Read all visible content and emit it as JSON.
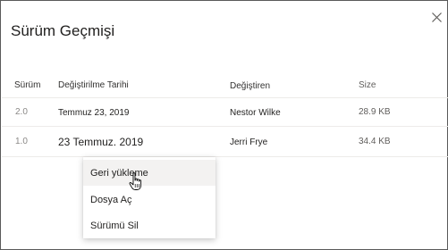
{
  "dialog": {
    "title": "Sürüm Geçmişi",
    "close_icon": "close-icon"
  },
  "table": {
    "headers": {
      "version": "Sürüm",
      "modified_date": "Değiştirilme Tarihi",
      "modified_by": "Değiştiren",
      "size": "Size"
    },
    "rows": [
      {
        "version": "2.0",
        "date": "Temmuz 23, 2019",
        "modified_by": "Nestor Wilke",
        "size": "28.9 KB"
      },
      {
        "version": "1.0",
        "date": "23 Temmuz. 2019",
        "modified_by": "Jerri Frye",
        "size": "34.4 KB"
      }
    ]
  },
  "context_menu": {
    "items": [
      {
        "label": "Geri yükleme"
      },
      {
        "label": "Dosya Aç"
      },
      {
        "label": "Sürümü Sil"
      }
    ]
  },
  "colors": {
    "border": "#5a5a5a",
    "separator": "#edebe9",
    "hover": "#f3f2f1",
    "muted_text": "#8a8886"
  },
  "cursor_icon": "hand-pointer-icon"
}
